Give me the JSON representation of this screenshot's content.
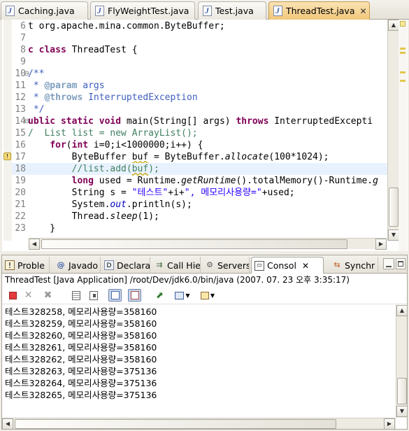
{
  "editor_tabs": [
    {
      "label": "Caching.java"
    },
    {
      "label": "FlyWeightTest.java"
    },
    {
      "label": "Test.java"
    },
    {
      "label": "ThreadTest.java",
      "active": true,
      "close": "✕"
    }
  ],
  "code": {
    "lines": [
      {
        "n": "6",
        "tokens": [
          [
            "",
            "t org.apache.mina.common.ByteBuffer;"
          ]
        ]
      },
      {
        "n": "7",
        "tokens": [
          [
            "",
            ""
          ]
        ]
      },
      {
        "n": "8",
        "tokens": [
          [
            "kw",
            "c class"
          ],
          [
            "",
            " ThreadTest {"
          ]
        ]
      },
      {
        "n": "9",
        "tokens": [
          [
            "",
            ""
          ]
        ]
      },
      {
        "n": "10",
        "tokens": [
          [
            "jd",
            "/**"
          ]
        ]
      },
      {
        "n": "11",
        "tokens": [
          [
            "jd",
            " * "
          ],
          [
            "jtag",
            "@param"
          ],
          [
            "jd",
            " args"
          ]
        ]
      },
      {
        "n": "12",
        "tokens": [
          [
            "jd",
            " * "
          ],
          [
            "jtag",
            "@throws"
          ],
          [
            "jd",
            " InterruptedException"
          ]
        ]
      },
      {
        "n": "13",
        "tokens": [
          [
            "jd",
            " */"
          ]
        ]
      },
      {
        "n": "14",
        "tokens": [
          [
            "kw",
            "ublic static void"
          ],
          [
            "",
            " main(String[] args) "
          ],
          [
            "kw",
            "throws"
          ],
          [
            "",
            " InterruptedExcepti"
          ]
        ]
      },
      {
        "n": "15",
        "tokens": [
          [
            "cm",
            "/  List list = new ArrayList();"
          ]
        ]
      },
      {
        "n": "16",
        "tokens": [
          [
            "",
            "    "
          ],
          [
            "kw",
            "for"
          ],
          [
            "",
            "("
          ],
          [
            "kw",
            "int"
          ],
          [
            "",
            " i=0;i<1000000;i++) {"
          ]
        ]
      },
      {
        "n": "17",
        "tokens": [
          [
            "",
            "        ByteBuffer "
          ],
          [
            "sq",
            "buf"
          ],
          [
            "",
            " = ByteBuffer."
          ],
          [
            "it",
            "allocate"
          ],
          [
            "",
            "(100*1024);"
          ]
        ]
      },
      {
        "n": "18",
        "hl": true,
        "tokens": [
          [
            "cm",
            "        //list.add("
          ],
          [
            "cmsq",
            "buf"
          ],
          [
            "cm",
            ");"
          ]
        ]
      },
      {
        "n": "19",
        "tokens": [
          [
            "",
            "        "
          ],
          [
            "kw",
            "long"
          ],
          [
            "",
            " used = Runtime."
          ],
          [
            "it",
            "getRuntime"
          ],
          [
            "",
            "().totalMemory()-Runtime."
          ],
          [
            "it",
            "g"
          ]
        ]
      },
      {
        "n": "20",
        "tokens": [
          [
            "",
            "        String s = "
          ],
          [
            "st",
            "\"테스트\""
          ],
          [
            "",
            "+i+"
          ],
          [
            "st",
            "\", 메모리사용량=\""
          ],
          [
            "",
            "+used;"
          ]
        ]
      },
      {
        "n": "21",
        "tokens": [
          [
            "",
            "        System."
          ],
          [
            "fl",
            "out"
          ],
          [
            "",
            ".println(s);"
          ]
        ]
      },
      {
        "n": "22",
        "tokens": [
          [
            "",
            "        Thread."
          ],
          [
            "it",
            "sleep"
          ],
          [
            "",
            "(1);"
          ]
        ]
      },
      {
        "n": "23",
        "tokens": [
          [
            "",
            "    }"
          ]
        ]
      }
    ]
  },
  "view_tabs": [
    {
      "label": "Proble",
      "icon": "problems-icon"
    },
    {
      "label": "Javado",
      "icon": "javadoc-icon"
    },
    {
      "label": "Declara",
      "icon": "declaration-icon"
    },
    {
      "label": "Call Hie",
      "icon": "call-hierarchy-icon"
    },
    {
      "label": "Servers",
      "icon": "servers-icon"
    },
    {
      "label": "Consol",
      "icon": "console-icon",
      "active": true,
      "close": "✕"
    },
    {
      "label": "Synchr",
      "icon": "synchronize-icon"
    }
  ],
  "console": {
    "title": "ThreadTest [Java Application] /root/Dev/jdk6.0/bin/java (2007. 07. 23 오후 3:35:17)",
    "output": [
      "테스트328258, 메모리사용량=358160",
      "테스트328259, 메모리사용량=358160",
      "테스트328260, 메모리사용량=358160",
      "테스트328261, 메모리사용량=358160",
      "테스트328262, 메모리사용량=358160",
      "테스트328263, 메모리사용량=375136",
      "테스트328264, 메모리사용량=375136",
      "테스트328265, 메모리사용량=375136"
    ]
  },
  "colors": {
    "keyword": "#7f0055",
    "comment": "#3f7f5f",
    "javadoc": "#3f5fbf",
    "string": "#2a00ff",
    "active_tab": "#f1c77a",
    "current_line": "#e8f2fe"
  }
}
